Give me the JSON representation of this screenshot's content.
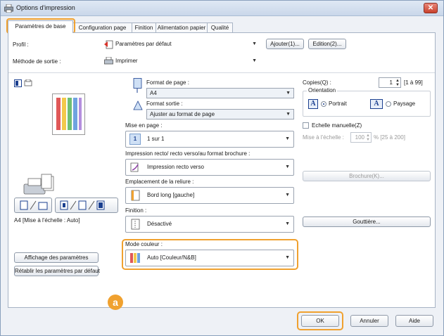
{
  "window": {
    "title": "Options d'impression",
    "close": "✕"
  },
  "tabs": [
    {
      "label": "Paramètres de base"
    },
    {
      "label": "Configuration page"
    },
    {
      "label": "Finition"
    },
    {
      "label": "Alimentation papier"
    },
    {
      "label": "Qualité"
    }
  ],
  "profile": {
    "label": "Profil :",
    "value": "Paramètres par défaut",
    "add_button": "Ajouter(1)...",
    "edit_button": "Edition(2)..."
  },
  "output_method": {
    "label": "Méthode de sortie :",
    "value": "Imprimer"
  },
  "preview": {
    "caption": "A4 [Mise à l'échelle : Auto]",
    "show_settings_button": "Affichage des paramètres",
    "restore_defaults_button": "Rétablir les paramètres par défaut"
  },
  "page_size": {
    "label": "Format de page :",
    "value": "A4"
  },
  "output_size": {
    "label": "Format sortie :",
    "value": "Ajuster au format de page"
  },
  "page_layout": {
    "label": "Mise en page :",
    "value": "1 sur 1",
    "icon_text": "1"
  },
  "duplex": {
    "label": "Impression recto/ recto verso/au format brochure :",
    "value": "Impression recto verso"
  },
  "binding": {
    "label": "Emplacement de la reliure :",
    "value": "Bord long [gauche]"
  },
  "finishing": {
    "label": "Finition :",
    "value": "Désactivé"
  },
  "color_mode": {
    "label": "Mode couleur :",
    "value": "Auto [Couleur/N&B]"
  },
  "callout": "a",
  "copies": {
    "label": "Copies(Q) :",
    "value": "1",
    "range": "[1 à 99]"
  },
  "orientation": {
    "label": "Orientation",
    "portrait": "Portrait",
    "landscape": "Paysage",
    "icon_letter": "A",
    "selected": "Portrait"
  },
  "manual_scaling": {
    "label": "Echelle manuelle(Z)",
    "scale_label": "Mise à l'échelle :",
    "scale_value": "100",
    "scale_range": "% [25 à 200]"
  },
  "brochure_button": "Brochure(K)...",
  "gutter_button": "Gouttière...",
  "footer": {
    "ok": "OK",
    "cancel": "Annuler",
    "help": "Aide"
  },
  "colors": {
    "highlight": "#f0a12f",
    "accent": "#1a3f8f"
  }
}
